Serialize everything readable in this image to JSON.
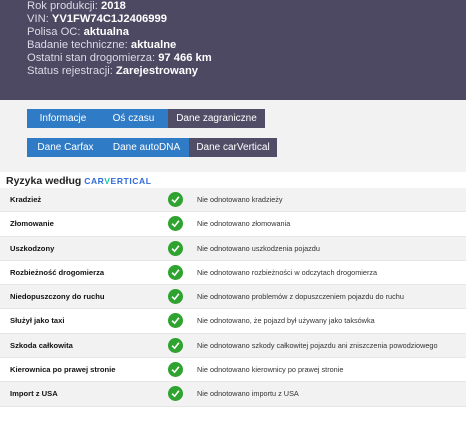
{
  "vehicle": {
    "items": [
      {
        "label": "Rok produkcji:",
        "value": "2018"
      },
      {
        "label": "VIN:",
        "value": "YV1FW74C1J2406999"
      },
      {
        "label": "Polisa OC:",
        "value": "aktualna"
      },
      {
        "label": "Badanie techniczne:",
        "value": "aktualne"
      },
      {
        "label": "Ostatni stan drogomierza:",
        "value": "97 466 km"
      },
      {
        "label": "Status rejestracji:",
        "value": "Zarejestrowany"
      }
    ]
  },
  "tabs_row1": [
    "Informacje",
    "Oś czasu",
    "Dane zagraniczne"
  ],
  "tabs_row2": [
    "Dane Carfax",
    "Dane autoDNA",
    "Dane carVertical"
  ],
  "risk": {
    "title": "Ryzyka według",
    "logo": {
      "part1": "CAR",
      "accent": "V",
      "part2": "ERTICAL"
    },
    "items": [
      {
        "name": "Kradzież",
        "status": "Nie odnotowano kradzieży"
      },
      {
        "name": "Złomowanie",
        "status": "Nie odnotowano złomowania"
      },
      {
        "name": "Uszkodzony",
        "status": "Nie odnotowano uszkodzenia pojazdu"
      },
      {
        "name": "Rozbieżność drogomierza",
        "status": "Nie odnotowano rozbieżności w odczytach drogomierza"
      },
      {
        "name": "Niedopuszczony do ruchu",
        "status": "Nie odnotowano problemów z dopuszczeniem pojazdu do ruchu"
      },
      {
        "name": "Służył jako taxi",
        "status": "Nie odnotowano, że pojazd był używany jako taksówka"
      },
      {
        "name": "Szkoda całkowita",
        "status": "Nie odnotowano szkody całkowitej pojazdu ani zniszczenia powodziowego"
      },
      {
        "name": "Kierownica po prawej stronie",
        "status": "Nie odnotowano kierownicy po prawej stronie"
      },
      {
        "name": "Import z USA",
        "status": "Nie odnotowano importu z USA"
      }
    ]
  },
  "colors": {
    "header_bg": "#4d4962",
    "tab_blue": "#2f7bc6",
    "tab_dark": "#514d67",
    "check_green": "#2fa32f"
  }
}
